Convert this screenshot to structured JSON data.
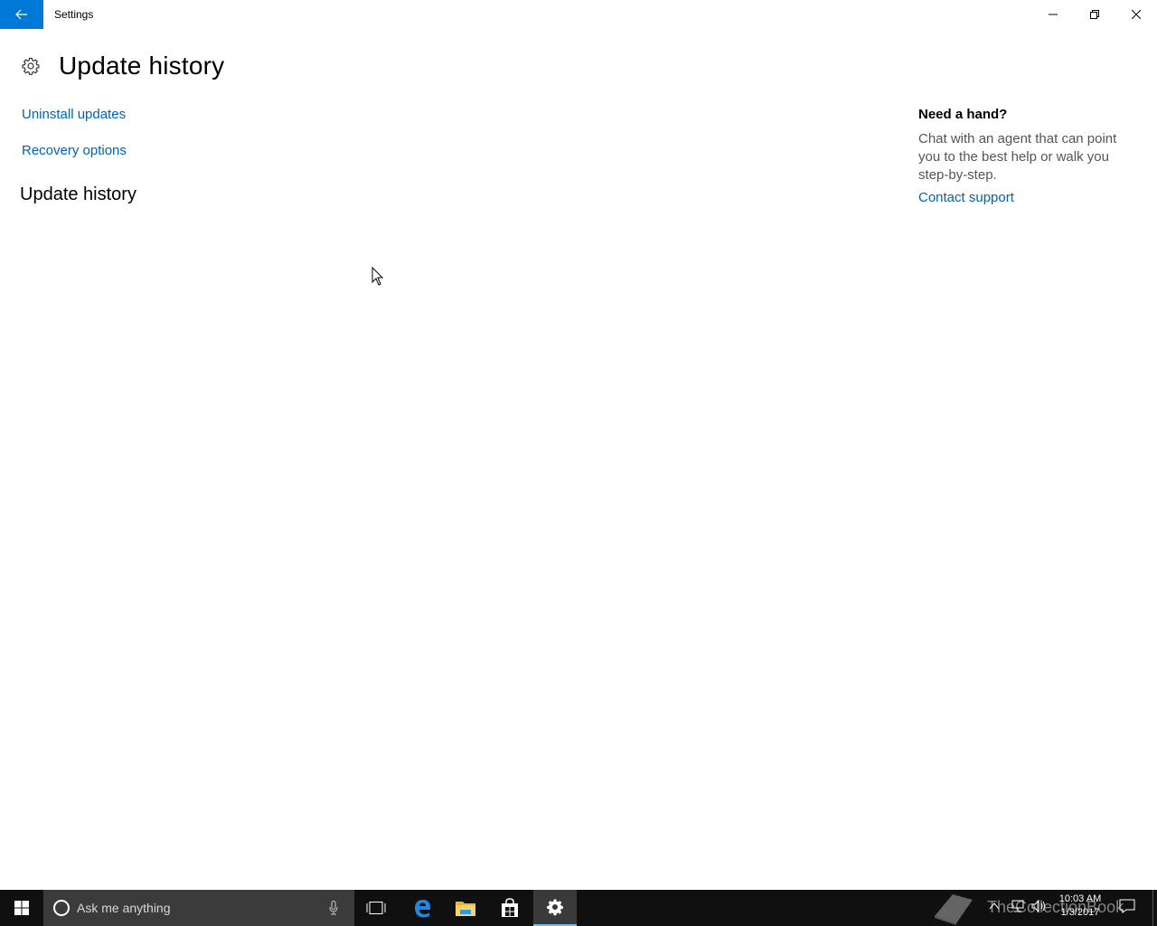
{
  "window": {
    "title": "Settings"
  },
  "page": {
    "title": "Update history",
    "links": {
      "uninstall": "Uninstall updates",
      "recovery": "Recovery options"
    },
    "section_title": "Update history"
  },
  "help": {
    "title": "Need a hand?",
    "text": "Chat with an agent that can point you to the best help or walk you step-by-step.",
    "link": "Contact support"
  },
  "taskbar": {
    "search_placeholder": "Ask me anything",
    "pinned": [
      "task-view-icon",
      "edge-icon",
      "file-explorer-icon",
      "store-icon",
      "settings-icon"
    ],
    "active_app": "settings-icon",
    "clock": {
      "time": "10:03 AM",
      "date": "1/3/2017"
    },
    "watermark": "TheCollectionBook"
  },
  "colors": {
    "accent": "#0078d7",
    "link": "#0063b1",
    "taskbar": "#101010"
  }
}
